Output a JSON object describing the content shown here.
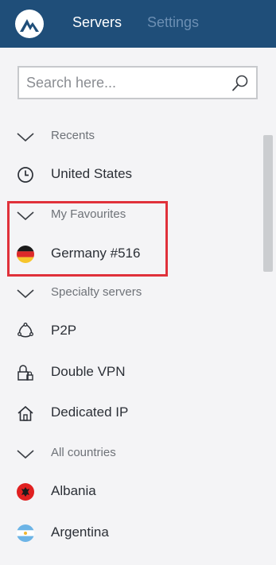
{
  "header": {
    "logo": "nordvpn-mountain-logo",
    "tabs": [
      {
        "label": "Servers",
        "active": true
      },
      {
        "label": "Settings",
        "active": false
      }
    ]
  },
  "search": {
    "placeholder": "Search here...",
    "value": "",
    "icon": "search-icon"
  },
  "list": {
    "recents_header": "Recents",
    "recent_item": "United States",
    "favourites_header": "My Favourites",
    "favourite_item": "Germany #516",
    "specialty_header": "Specialty servers",
    "specialty_items": [
      "P2P",
      "Double VPN",
      "Dedicated IP"
    ],
    "countries_header": "All countries",
    "country_items": [
      "Albania",
      "Argentina"
    ]
  },
  "colors": {
    "header_bg": "#1f4e79",
    "active_tab": "#ffffff",
    "inactive_tab": "#6c8fb3",
    "highlight_border": "#e0313a"
  }
}
